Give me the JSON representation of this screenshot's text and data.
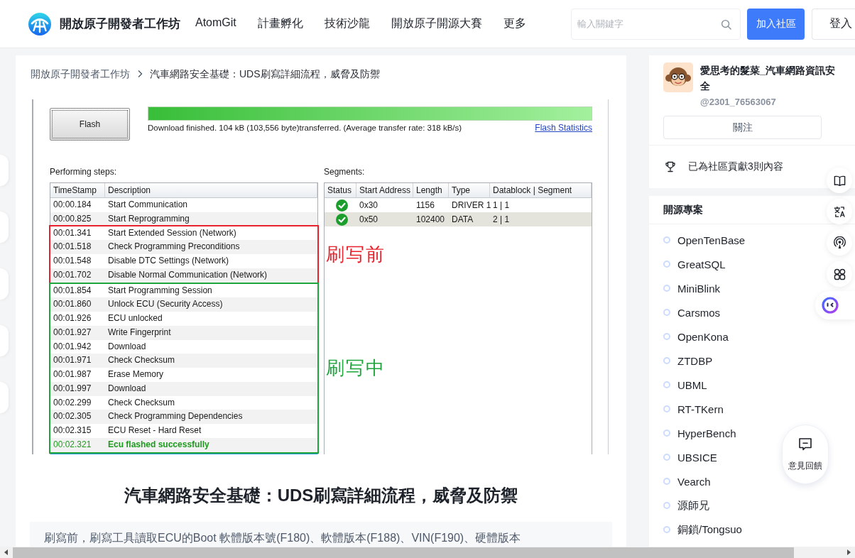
{
  "header": {
    "logo_text": "開放原子開發者工作坊",
    "nav": [
      "AtomGit",
      "計畫孵化",
      "技術沙龍",
      "開放原子開源大賽",
      "更多"
    ],
    "search": {
      "placeholder": "輸入關鍵字"
    },
    "join_button": "加入社區",
    "login_button": "登入"
  },
  "breadcrumb": [
    "開放原子開發者工作坊",
    "汽車網路安全基礎：UDS刷寫詳細流程，威脅及防禦"
  ],
  "flash_window": {
    "flash_button": "Flash",
    "progress": {
      "level": 1
    },
    "message": "Download finished. 104 kB (103,556 byte)transferred. (Average transfer rate: 318 kB/s)",
    "statistics_link": "Flash Statistics",
    "steps": {
      "title": "Performing steps:",
      "columns": [
        "TimeStamp",
        "Description"
      ],
      "groups": [
        {
          "rows": [
            {
              "kind": "step",
              "time": "00:00.184",
              "description": "Start Communication"
            },
            {
              "kind": "step",
              "time": "00:00.825",
              "description": "Start Reprogramming"
            }
          ]
        },
        {
          "label": "刷写前",
          "color": "#e8222c",
          "rows": [
            {
              "kind": "step",
              "time": "00:01.341",
              "description": "Start Extended Session (Network)"
            },
            {
              "kind": "step",
              "time": "00:01.518",
              "description": "Check Programming Preconditions"
            },
            {
              "kind": "step",
              "time": "00:01.548",
              "description": "Disable DTC Settings (Network)"
            },
            {
              "kind": "step",
              "time": "00:01.702",
              "description": "Disable Normal Communication (Network)"
            }
          ]
        },
        {
          "label": "刷写中",
          "color": "#1ea53c",
          "rows": [
            {
              "kind": "step",
              "time": "00:01.854",
              "description": "Start Programming Session"
            },
            {
              "kind": "step",
              "time": "00:01.860",
              "description": "Unlock ECU (Security Access)"
            },
            {
              "kind": "step",
              "time": "00:01.926",
              "description": "ECU unlocked"
            },
            {
              "kind": "step",
              "time": "00:01.927",
              "description": "Write Fingerprint"
            },
            {
              "kind": "step",
              "time": "00:01.942",
              "description": "Download"
            },
            {
              "kind": "step",
              "time": "00:01.971",
              "description": "Check Checksum"
            },
            {
              "kind": "step",
              "time": "00:01.987",
              "description": "Erase Memory"
            },
            {
              "kind": "step",
              "time": "00:01.997",
              "description": "Download"
            },
            {
              "kind": "step",
              "time": "00:02.299",
              "description": "Check Checksum"
            },
            {
              "kind": "step",
              "time": "00:02.305",
              "description": "Check Programming Dependencies"
            },
            {
              "kind": "step",
              "time": "00:02.315",
              "description": "ECU Reset - Hard Reset"
            },
            {
              "kind": "success",
              "time": "00:02.321",
              "description": "Ecu flashed successfully"
            }
          ]
        }
      ]
    },
    "segments": {
      "title": "Segments:",
      "status_column": "Status",
      "columns": [
        "Start Address",
        "Length",
        "Type",
        "Datablock | Segment"
      ],
      "rows": [
        {
          "ok": true,
          "selected": false,
          "cells": [
            "0x30",
            "1156",
            "DRIVER 1",
            "1 | 1"
          ]
        },
        {
          "ok": true,
          "selected": true,
          "cells": [
            "0x50",
            "102400",
            "DATA",
            "2 | 1"
          ]
        }
      ]
    }
  },
  "article_title": "汽車網路安全基礎：UDS刷寫詳細流程，威脅及防禦",
  "summary": "刷寫前，刷寫工具讀取ECU的Boot 軟體版本號(F180)、軟體版本(F188)、VIN(F190)、硬體版本",
  "author": {
    "name": "愛思考的髮菜_汽車網路資訊安全",
    "handle": "@2301_76563067",
    "follow_button": "關注",
    "contribution": "已為社區貢獻3則內容"
  },
  "projects": {
    "title": "開源專案",
    "items": [
      "OpenTenBase",
      "GreatSQL",
      "MiniBlink",
      "Carsmos",
      "OpenKona",
      "ZTDBP",
      "UBML",
      "RT-TKern",
      "HyperBench",
      "UBSICE",
      "Vearch",
      "源師兄",
      "銅鎖/Tongsuo"
    ]
  },
  "feedback": {
    "label": "意見回饋"
  }
}
